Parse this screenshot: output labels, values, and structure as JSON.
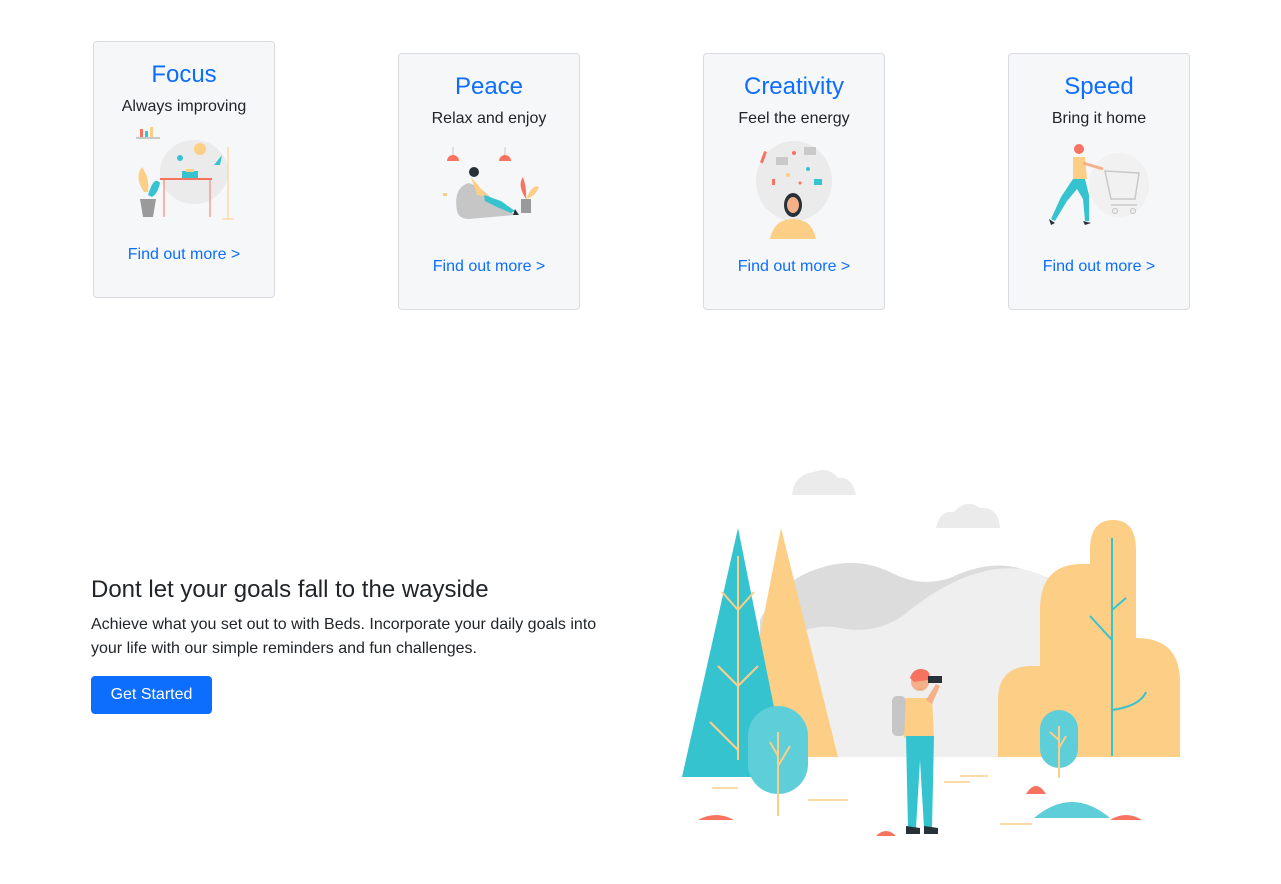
{
  "cards": [
    {
      "title": "Focus",
      "subtitle": "Always improving",
      "link": "Find out more >",
      "illustration": "desk-workspace-illustration"
    },
    {
      "title": "Peace",
      "subtitle": "Relax and enjoy",
      "link": "Find out more >",
      "illustration": "person-relaxing-illustration"
    },
    {
      "title": "Creativity",
      "subtitle": "Feel the energy",
      "link": "Find out more >",
      "illustration": "person-ideas-illustration"
    },
    {
      "title": "Speed",
      "subtitle": "Bring it home",
      "link": "Find out more >",
      "illustration": "person-pushing-cart-illustration"
    }
  ],
  "cta": {
    "title": "Dont let your goals fall to the wayside",
    "text": "Achieve what you set out to with Beds. Incorporate your daily goals into your life with our simple reminders and fun challenges.",
    "button": "Get Started"
  },
  "hero": {
    "illustration": "hiker-with-binoculars-landscape-illustration"
  },
  "colors": {
    "accent": "#0d6efd",
    "teal": "#36c3d0",
    "orange": "#fdce85",
    "coral": "#f8735f"
  }
}
